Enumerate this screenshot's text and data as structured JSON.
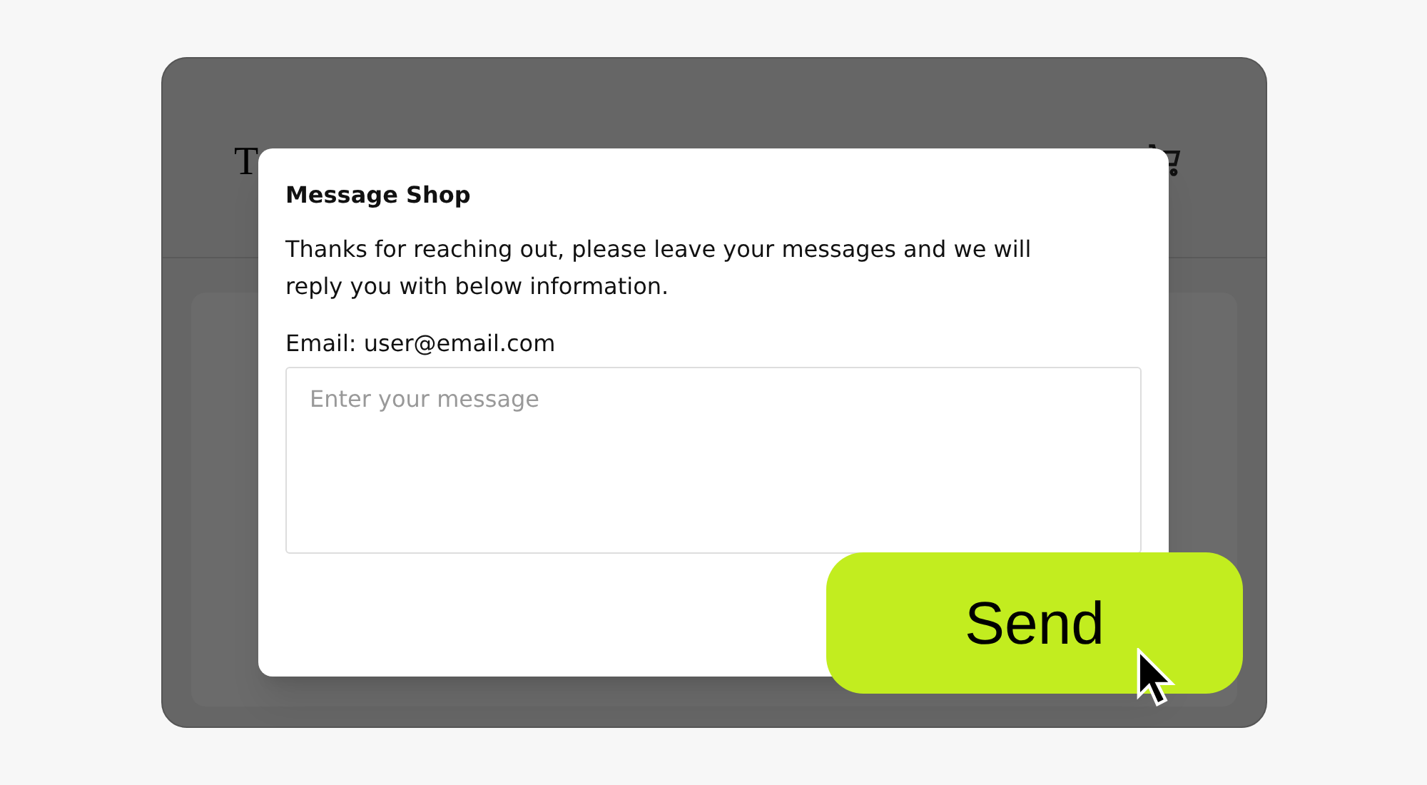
{
  "page": {
    "title": "T"
  },
  "dialog": {
    "title": "Message Shop",
    "message": "Thanks for reaching out, please leave your messages and we will reply you with below information.",
    "email_label": "Email: user@email.com",
    "message_field": {
      "placeholder": "Enter your message"
    }
  },
  "send_button": {
    "label": "Send"
  }
}
